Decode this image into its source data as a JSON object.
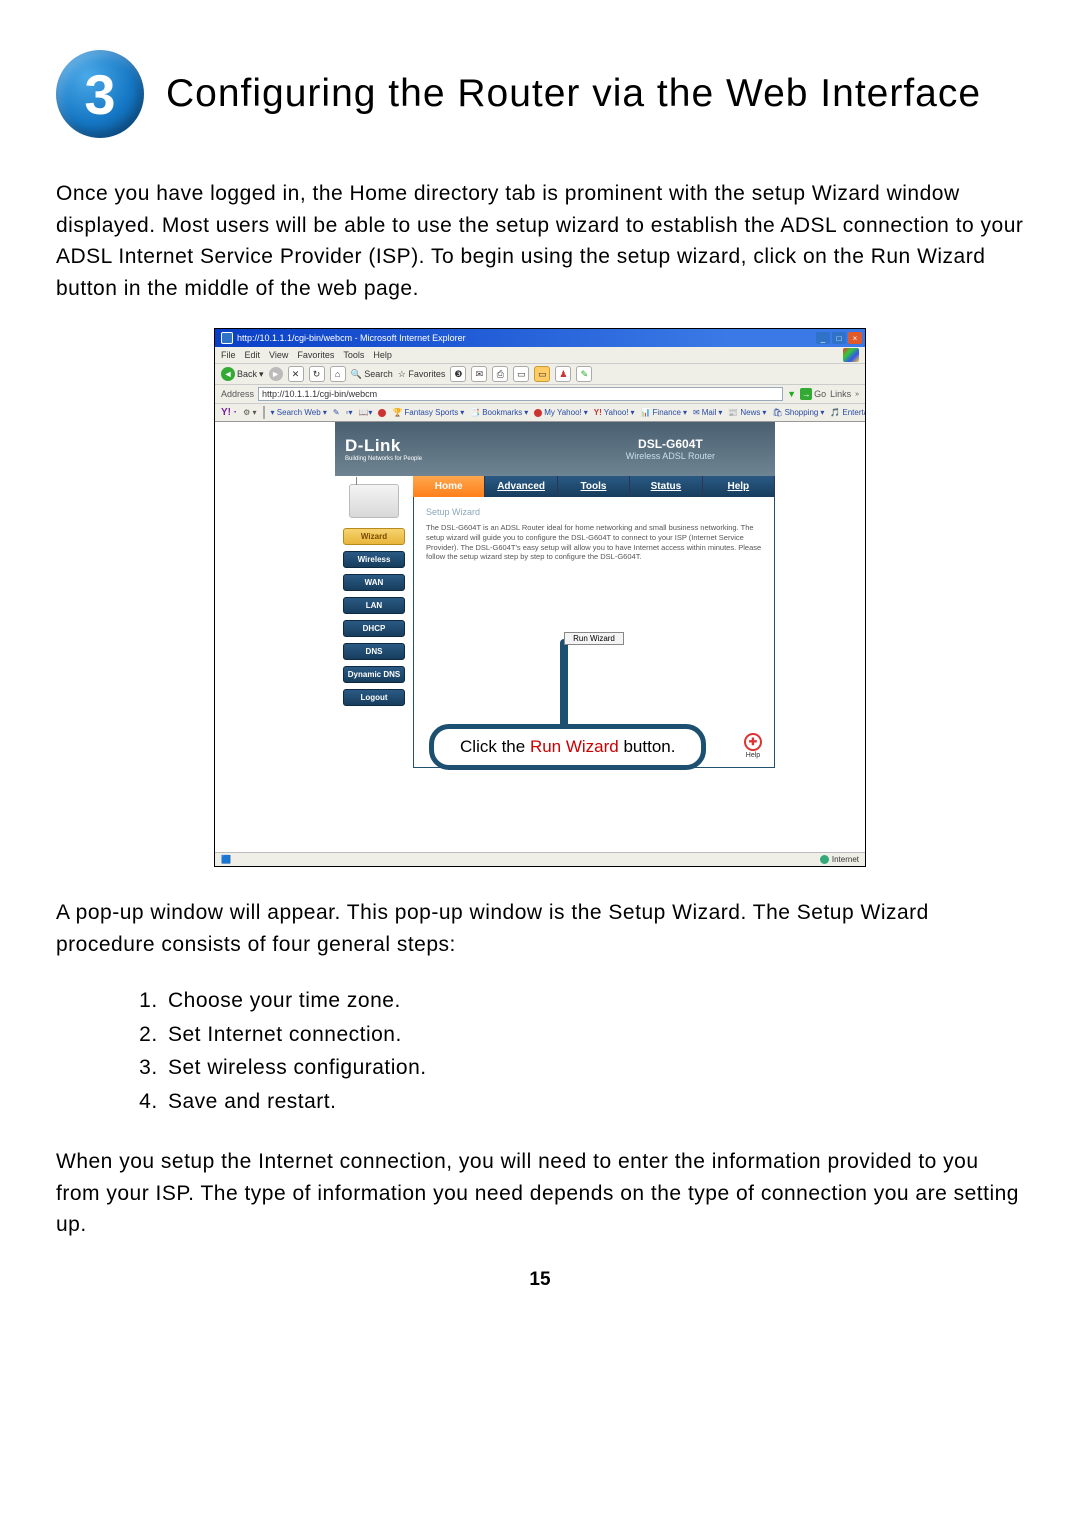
{
  "step_badge": "3",
  "heading": "Configuring the Router via the Web Interface",
  "intro": "Once you have logged in, the Home directory tab is prominent with the setup Wizard window displayed. Most users will be able to use the setup wizard to establish the ADSL connection to your ADSL Internet Service Provider (ISP). To begin using the setup wizard, click on the Run Wizard button in the middle of the web page.",
  "browser": {
    "title": "http://10.1.1.1/cgi-bin/webcm - Microsoft Internet Explorer",
    "menus": [
      "File",
      "Edit",
      "View",
      "Favorites",
      "Tools",
      "Help"
    ],
    "toolbar": {
      "back": "Back",
      "search": "Search",
      "favorites": "Favorites"
    },
    "address_label": "Address",
    "address_value": "http://10.1.1.1/cgi-bin/webcm",
    "go": "Go",
    "links": "Links",
    "yahoo": {
      "logo": "Y! ·",
      "search": "Search Web",
      "items": [
        "Fantasy Sports",
        "Bookmarks",
        "My Yahoo!",
        "Yahoo!",
        "Finance",
        "Mail",
        "News",
        "Shopping",
        "Entertainment"
      ]
    },
    "status_left": "",
    "status_right": "Internet"
  },
  "router": {
    "brand": "D-Link",
    "brand_sub": "Building Networks for People",
    "model": "DSL-G604T",
    "model_sub": "Wireless ADSL Router",
    "tabs": [
      "Home",
      "Advanced",
      "Tools",
      "Status",
      "Help"
    ],
    "sidebar": [
      "Wizard",
      "Wireless",
      "WAN",
      "LAN",
      "DHCP",
      "DNS",
      "Dynamic DNS",
      "Logout"
    ],
    "wizard_title": "Setup Wizard",
    "wizard_desc": "The DSL-G604T is an ADSL Router ideal for home networking and small business networking. The setup wizard will guide you to configure the DSL-G604T to connect to your ISP (Internet Service Provider). The DSL-G604T's easy setup will allow you to have Internet access within minutes. Please follow the setup wizard step by step to configure the DSL-G604T.",
    "run_wizard": "Run Wizard",
    "help": "Help"
  },
  "callout_pre": "Click the ",
  "callout_hl": "Run Wizard",
  "callout_post": " button.",
  "after_para": "A pop-up window will appear. This pop-up window is the Setup Wizard. The Setup Wizard procedure consists of four general steps:",
  "steps": [
    "Choose your time zone.",
    "Set Internet connection.",
    "Set wireless configuration.",
    "Save and restart."
  ],
  "closing": "When you setup the Internet connection, you will need to enter the information provided to you from your ISP. The type of information you need depends on the type of connection you are setting up.",
  "page_number": "15"
}
